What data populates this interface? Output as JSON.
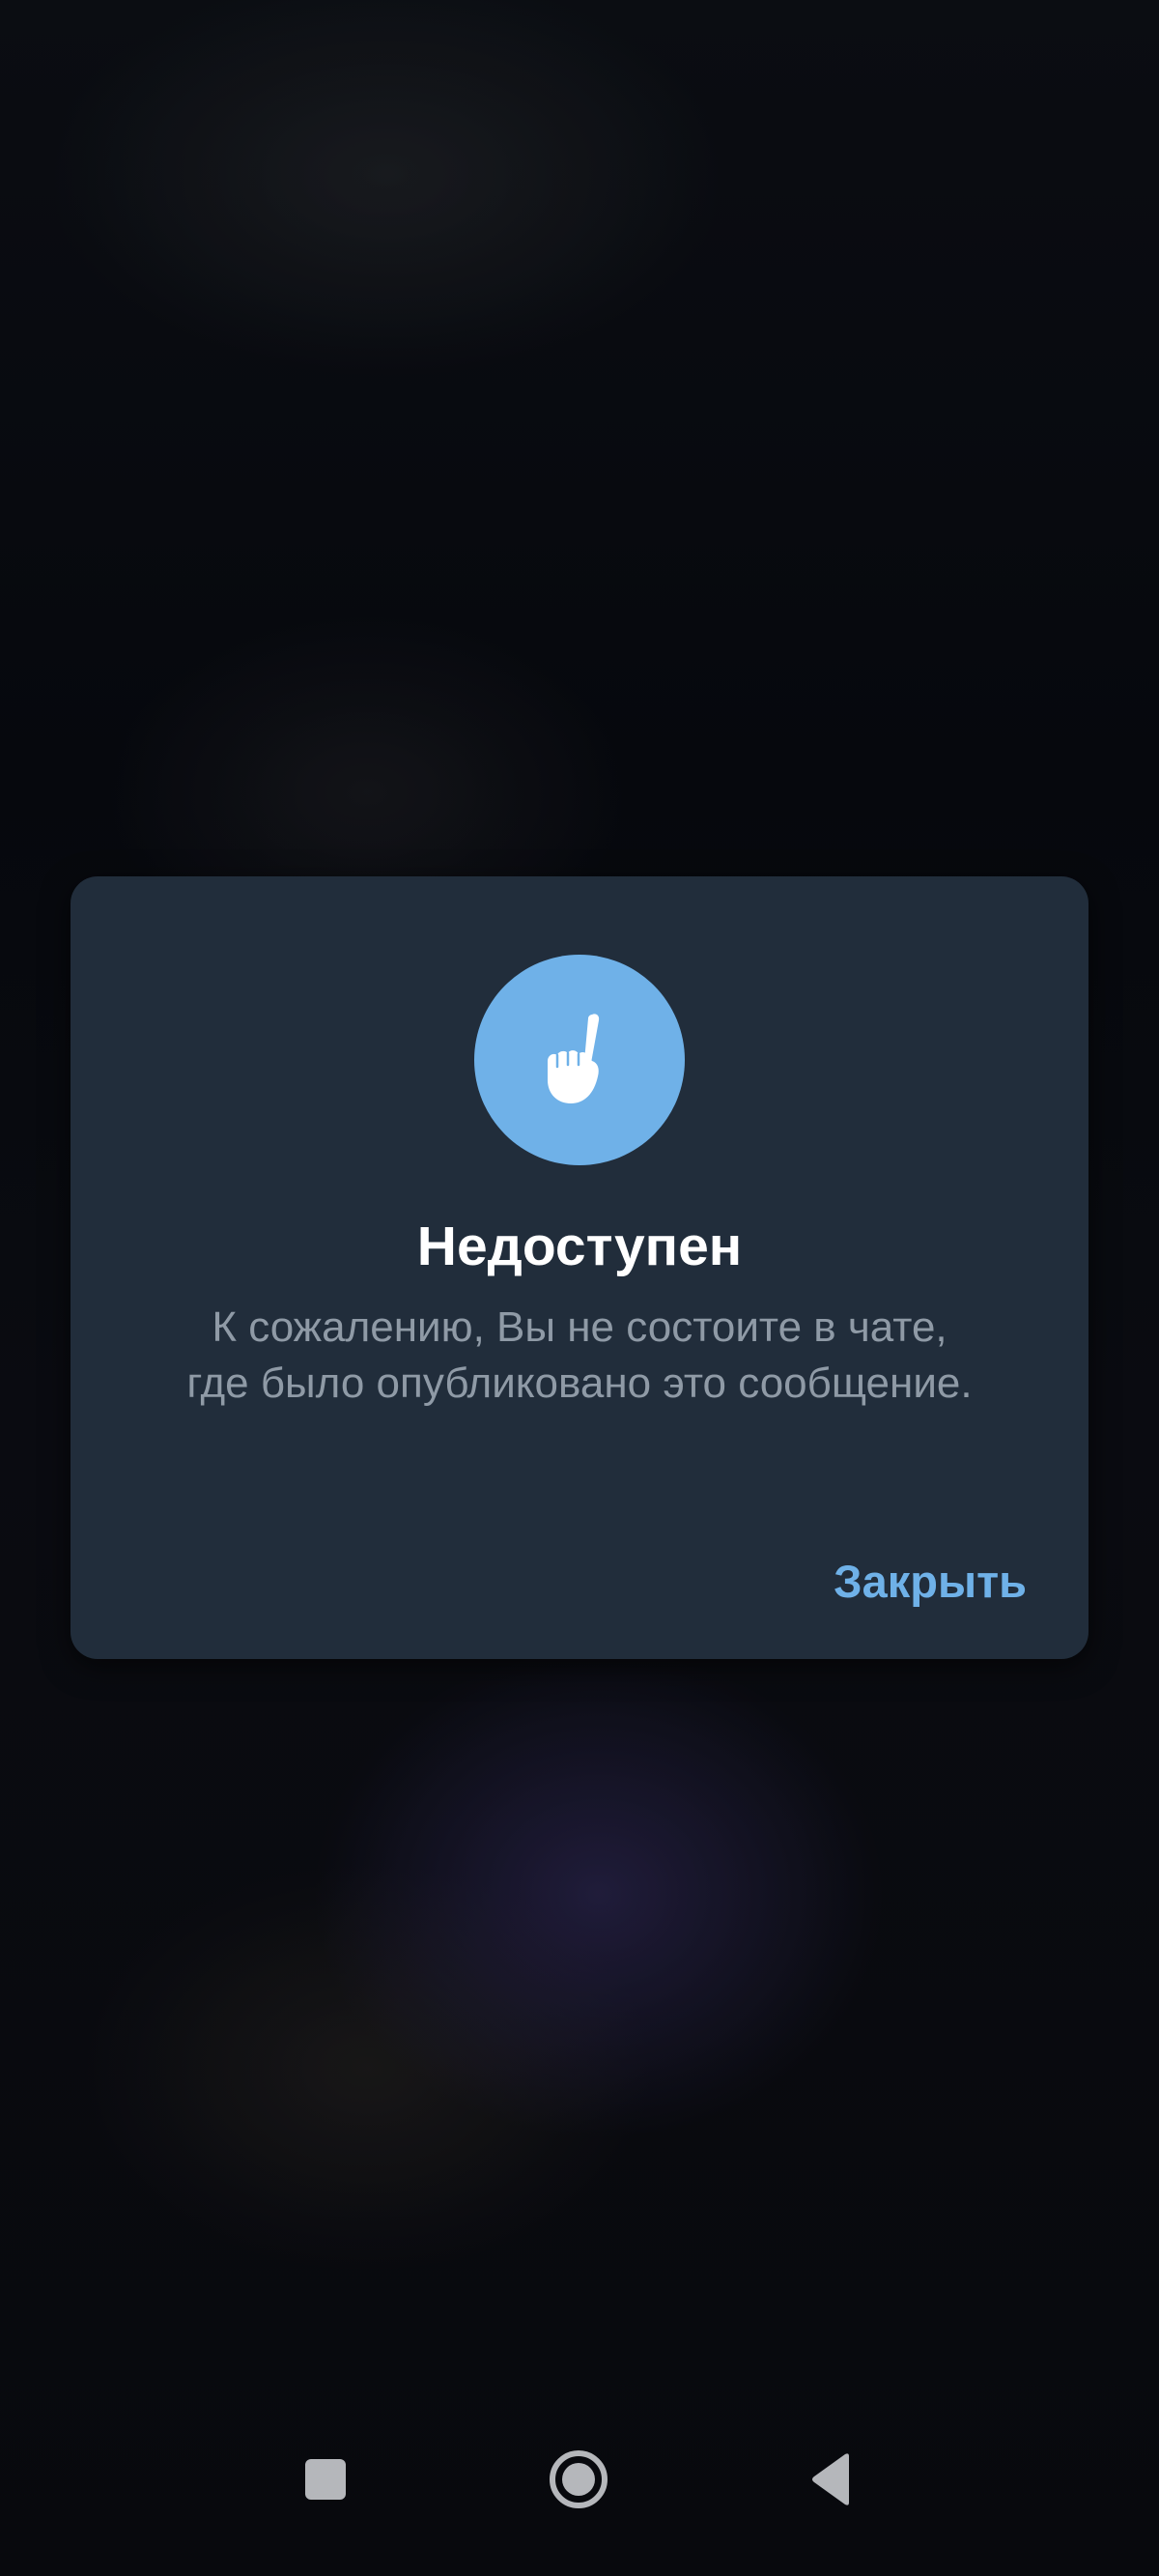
{
  "dialog": {
    "icon": "pointing-hand-icon",
    "title": "Недоступен",
    "message": "К сожалению, Вы не состоите в чате, где было опубликовано это сообщение.",
    "close_label": "Закрыть"
  },
  "navbar": {
    "recents_icon": "square-icon",
    "home_icon": "circle-home-icon",
    "back_icon": "triangle-back-icon"
  },
  "colors": {
    "dialog_background": "#212d3b",
    "accent": "#6fb1e8",
    "title_text": "#ffffff",
    "message_text": "#8f9aa6",
    "nav_icons": "#b5b7bb"
  }
}
